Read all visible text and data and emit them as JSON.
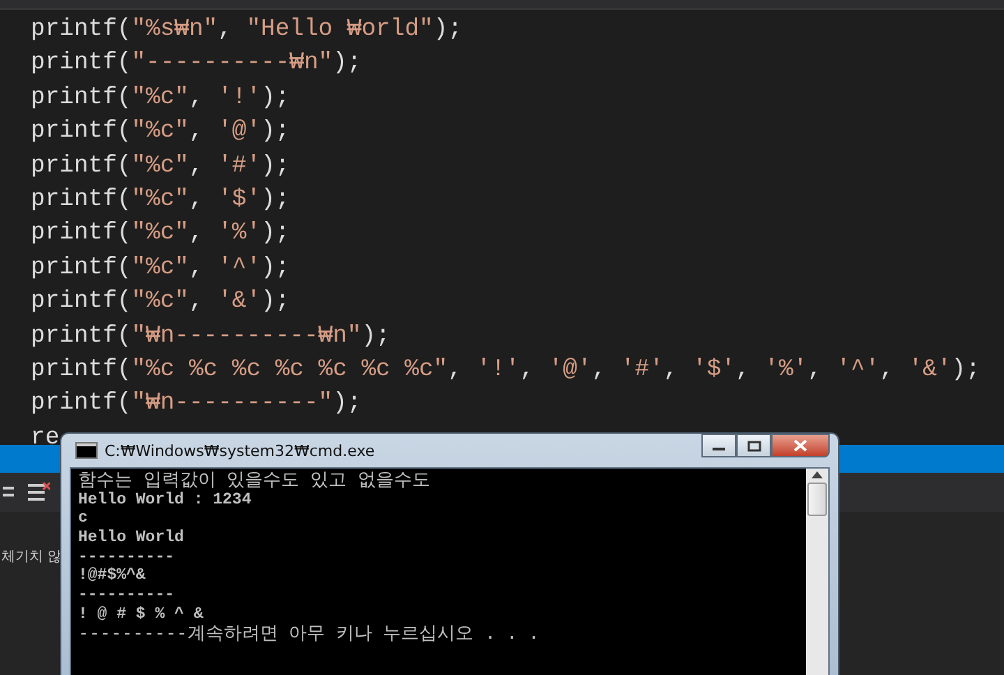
{
  "editor": {
    "code_lines": [
      [
        {
          "kind": "plain",
          "text": "printf("
        },
        {
          "kind": "string",
          "text": "\"%s₩n\""
        },
        {
          "kind": "plain",
          "text": ", "
        },
        {
          "kind": "string",
          "text": "\"Hello ₩orld\""
        },
        {
          "kind": "plain",
          "text": ");"
        }
      ],
      [
        {
          "kind": "plain",
          "text": "printf("
        },
        {
          "kind": "string",
          "text": "\"----------₩n\""
        },
        {
          "kind": "plain",
          "text": ");"
        }
      ],
      [
        {
          "kind": "plain",
          "text": "printf("
        },
        {
          "kind": "string",
          "text": "\"%c\""
        },
        {
          "kind": "plain",
          "text": ", "
        },
        {
          "kind": "string",
          "text": "'!'"
        },
        {
          "kind": "plain",
          "text": ");"
        }
      ],
      [
        {
          "kind": "plain",
          "text": "printf("
        },
        {
          "kind": "string",
          "text": "\"%c\""
        },
        {
          "kind": "plain",
          "text": ", "
        },
        {
          "kind": "string",
          "text": "'@'"
        },
        {
          "kind": "plain",
          "text": ");"
        }
      ],
      [
        {
          "kind": "plain",
          "text": "printf("
        },
        {
          "kind": "string",
          "text": "\"%c\""
        },
        {
          "kind": "plain",
          "text": ", "
        },
        {
          "kind": "string",
          "text": "'#'"
        },
        {
          "kind": "plain",
          "text": ");"
        }
      ],
      [
        {
          "kind": "plain",
          "text": "printf("
        },
        {
          "kind": "string",
          "text": "\"%c\""
        },
        {
          "kind": "plain",
          "text": ", "
        },
        {
          "kind": "string",
          "text": "'$'"
        },
        {
          "kind": "plain",
          "text": ");"
        }
      ],
      [
        {
          "kind": "plain",
          "text": "printf("
        },
        {
          "kind": "string",
          "text": "\"%c\""
        },
        {
          "kind": "plain",
          "text": ", "
        },
        {
          "kind": "string",
          "text": "'%'"
        },
        {
          "kind": "plain",
          "text": ");"
        }
      ],
      [
        {
          "kind": "plain",
          "text": "printf("
        },
        {
          "kind": "string",
          "text": "\"%c\""
        },
        {
          "kind": "plain",
          "text": ", "
        },
        {
          "kind": "string",
          "text": "'^'"
        },
        {
          "kind": "plain",
          "text": ");"
        }
      ],
      [
        {
          "kind": "plain",
          "text": "printf("
        },
        {
          "kind": "string",
          "text": "\"%c\""
        },
        {
          "kind": "plain",
          "text": ", "
        },
        {
          "kind": "string",
          "text": "'&'"
        },
        {
          "kind": "plain",
          "text": ");"
        }
      ],
      [
        {
          "kind": "plain",
          "text": "printf("
        },
        {
          "kind": "string",
          "text": "\"₩n----------₩n\""
        },
        {
          "kind": "plain",
          "text": ");"
        }
      ],
      [
        {
          "kind": "plain",
          "text": "printf("
        },
        {
          "kind": "string",
          "text": "\"%c %c %c %c %c %c %c\""
        },
        {
          "kind": "plain",
          "text": ", "
        },
        {
          "kind": "string",
          "text": "'!'"
        },
        {
          "kind": "plain",
          "text": ", "
        },
        {
          "kind": "string",
          "text": "'@'"
        },
        {
          "kind": "plain",
          "text": ", "
        },
        {
          "kind": "string",
          "text": "'#'"
        },
        {
          "kind": "plain",
          "text": ", "
        },
        {
          "kind": "string",
          "text": "'$'"
        },
        {
          "kind": "plain",
          "text": ", "
        },
        {
          "kind": "string",
          "text": "'%'"
        },
        {
          "kind": "plain",
          "text": ", "
        },
        {
          "kind": "string",
          "text": "'^'"
        },
        {
          "kind": "plain",
          "text": ", "
        },
        {
          "kind": "string",
          "text": "'&'"
        },
        {
          "kind": "plain",
          "text": ");"
        }
      ],
      [
        {
          "kind": "plain",
          "text": "printf("
        },
        {
          "kind": "string",
          "text": "\"₩n----------\""
        },
        {
          "kind": "plain",
          "text": ");"
        }
      ],
      [
        {
          "kind": "plain",
          "text": "re"
        }
      ]
    ]
  },
  "output_panel": {
    "message": "체기치 않"
  },
  "console": {
    "title": "C:₩Windows₩system32₩cmd.exe",
    "lines": [
      "함수는 입력값이 있을수도 있고 없을수도",
      "Hello World : 1234",
      "c",
      "Hello World",
      "----------",
      "!@#$%^&",
      "----------",
      "! @ # $ % ^ &",
      "----------계속하려면 아무 키나 누르십시오 . . ."
    ]
  }
}
